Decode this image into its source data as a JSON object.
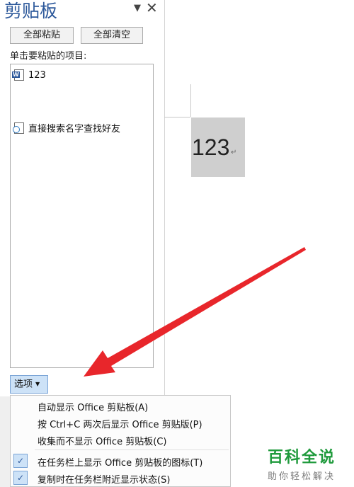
{
  "pane": {
    "title": "剪贴板",
    "arrow_glyph": "▼",
    "close_glyph": "✕",
    "paste_all_label": "全部粘贴",
    "clear_all_label": "全部清空",
    "items_label": "单击要粘贴的项目:",
    "items": [
      {
        "icon": "word-doc-icon",
        "text": "123"
      },
      {
        "icon": "web-page-icon",
        "text": "直接搜索名字查找好友"
      }
    ],
    "options_label": "选项",
    "options_caret": "▼"
  },
  "document": {
    "selected_text": "123",
    "paragraph_mark": "↵"
  },
  "options_menu": {
    "items": [
      {
        "label": "自动显示 Office 剪贴板(A)",
        "checked": false
      },
      {
        "label": "按 Ctrl+C 两次后显示 Office 剪贴版(P)",
        "checked": false
      },
      {
        "label": "收集而不显示 Office 剪贴板(C)",
        "checked": false
      },
      {
        "label": "在任务栏上显示 Office 剪贴板的图标(T)",
        "checked": true
      },
      {
        "label": "复制时在任务栏附近显示状态(S)",
        "checked": true
      }
    ],
    "check_glyph": "✓"
  },
  "watermark": {
    "title": "百科全说",
    "subtitle": "助你轻松解决"
  },
  "colors": {
    "title_blue": "#2b579a",
    "selection_gray": "#cfcfcf",
    "arrow_red": "#e8262b",
    "watermark_green": "#1f9a3c",
    "check_bg": "#cde2f7"
  }
}
